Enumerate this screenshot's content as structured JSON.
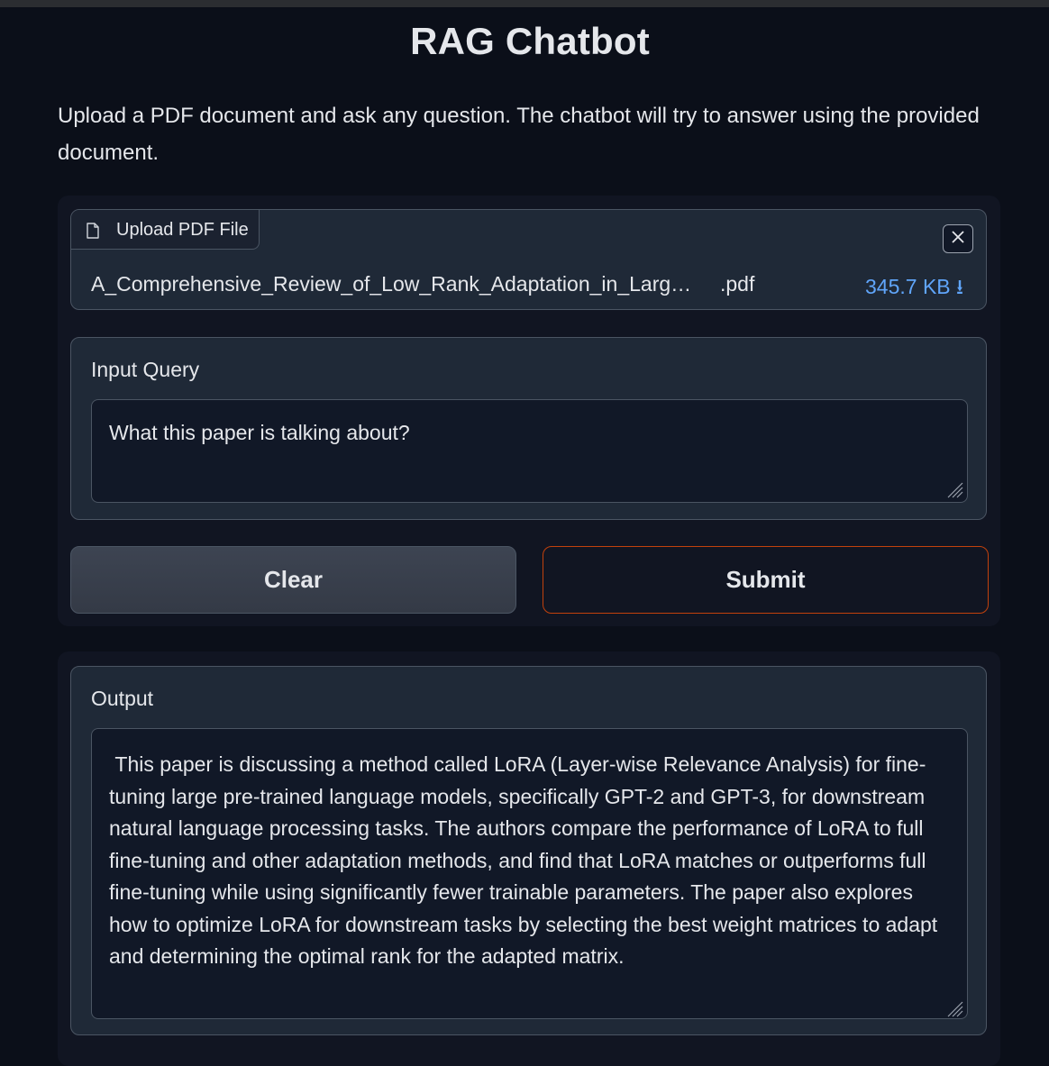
{
  "app": {
    "title": "RAG Chatbot",
    "description": "Upload a PDF document and ask any question. The chatbot will try to answer using the provided document."
  },
  "file_upload": {
    "label": "Upload PDF File",
    "file_name": "A_Comprehensive_Review_of_Low_Rank_Adaptation_in_Larg…",
    "file_ext": ".pdf",
    "file_size": "345.7 KB ⭳",
    "icons": [
      "file-icon",
      "close-icon",
      "download-icon"
    ]
  },
  "query": {
    "label": "Input Query",
    "value": "What this paper is talking about?"
  },
  "buttons": {
    "clear_label": "Clear",
    "submit_label": "Submit"
  },
  "output": {
    "label": "Output",
    "value": " This paper is discussing a method called LoRA (Layer-wise Relevance Analysis) for fine-tuning large pre-trained language models, specifically GPT-2 and GPT-3, for downstream natural language processing tasks. The authors compare the performance of LoRA to full fine-tuning and other adaptation methods, and find that LoRA matches or outperforms full fine-tuning while using significantly fewer trainable parameters. The paper also explores how to optimize LoRA for downstream tasks by selecting the best weight matrices to adapt and determining the optimal rank for the adapted matrix."
  },
  "colors": {
    "background": "#0b0f19",
    "panel": "#1f2937",
    "link_blue": "#60a5fa",
    "submit_border": "#c2410c"
  }
}
